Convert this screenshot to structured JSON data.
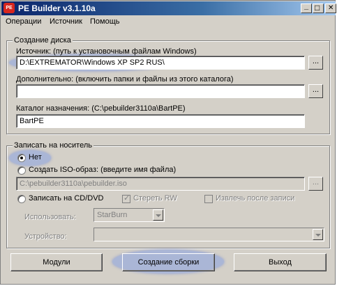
{
  "window": {
    "icon_label": "PE",
    "title": "PE Builder v3.1.10a",
    "minimize_glyph": "_",
    "maximize_glyph": "□",
    "close_glyph": "✕"
  },
  "menu": [
    "Операции",
    "Источник",
    "Помощь"
  ],
  "disk_group": {
    "legend": "Создание диска",
    "source_label": "Источник: (путь к установочным файлам Windows)",
    "source_value": "D:\\EXTREMATOR\\Windows XP SP2 RUS\\",
    "extra_label": "Дополнительно: (включить папки и файлы из этого каталога)",
    "extra_value": "",
    "target_label": "Каталог назначения: (C:\\pebuilder3110a\\BartPE)",
    "target_value": "BartPE",
    "browse_label": "..."
  },
  "media_group": {
    "legend": "Записать на носитель",
    "option_none": "Нет",
    "option_iso": "Создать ISO-образ: (введите имя файла)",
    "iso_value": "C:\\pebuilder3110a\\pebuilder.iso",
    "option_cd": "Записать на CD/DVD",
    "erase_rw": "Стереть RW",
    "eject_after": "Извлечь после записи",
    "use_label": "Использовать:",
    "use_value": "StarBurn",
    "device_label": "Устройство:",
    "device_value": "",
    "selected_option": "Нет"
  },
  "buttons": {
    "modules": "Модули",
    "build": "Создание сборки",
    "exit": "Выход"
  }
}
